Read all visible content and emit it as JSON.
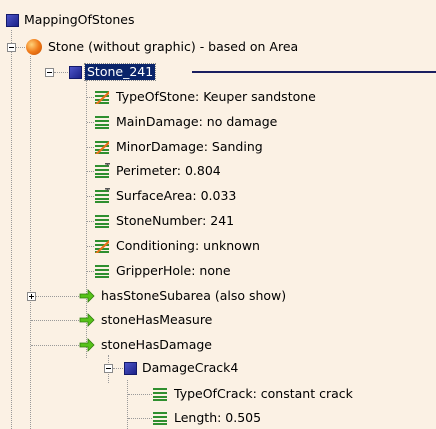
{
  "tree": {
    "root": {
      "label": "MappingOfStones",
      "icon": "blue-square-icon"
    },
    "stone": {
      "label": "Stone (without graphic) - based on Area",
      "icon": "orange-ball-icon"
    },
    "stone241": {
      "label": "Stone_241",
      "icon": "blue-square-icon"
    },
    "attributes": [
      {
        "label": "TypeOfStone: Keuper sandstone",
        "icon": "list-orange-icon"
      },
      {
        "label": "MainDamage: no damage",
        "icon": "list-green-icon"
      },
      {
        "label": "MinorDamage: Sanding",
        "icon": "list-orange-icon"
      },
      {
        "label": "Perimeter: 0.804",
        "icon": "list-plus-icon"
      },
      {
        "label": "SurfaceArea: 0.033",
        "icon": "list-plus-icon"
      },
      {
        "label": "StoneNumber: 241",
        "icon": "list-green-icon"
      },
      {
        "label": "Conditioning: unknown",
        "icon": "list-orange-icon"
      },
      {
        "label": "GripperHole: none",
        "icon": "list-green-icon"
      }
    ],
    "relations": [
      {
        "label": "hasStoneSubarea (also show)",
        "icon": "arrow-right-icon"
      },
      {
        "label": "stoneHasMeasure",
        "icon": "arrow-right-icon"
      },
      {
        "label": "stoneHasDamage",
        "icon": "arrow-right-icon"
      }
    ],
    "damage": {
      "label": "DamageCrack4",
      "icon": "blue-square-icon"
    },
    "damage_attributes": [
      {
        "label": "TypeOfCrack: constant crack",
        "icon": "list-green-icon"
      },
      {
        "label": "Length: 0.505",
        "icon": "list-green-icon"
      }
    ]
  }
}
